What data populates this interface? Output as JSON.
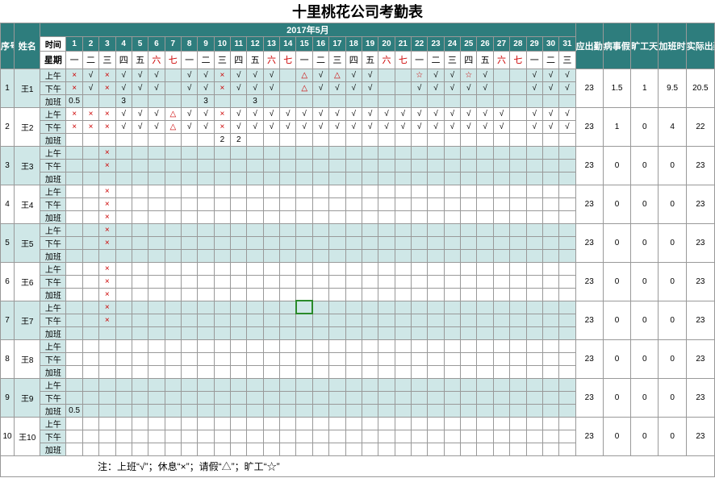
{
  "title": "十里桃花公司考勤表",
  "period": "2017年5月",
  "hdr": {
    "seq": "序号",
    "name": "姓名",
    "time": "时间",
    "wday": "星期",
    "sum1": "应出勤天数",
    "sum2": "病事假天数",
    "sum3": "旷工天数",
    "sum4": "加班时间／h",
    "sum5": "实际出勤天数"
  },
  "sessions": [
    "上午",
    "下午",
    "加班"
  ],
  "days": [
    {
      "n": "1",
      "w": "一"
    },
    {
      "n": "2",
      "w": "二"
    },
    {
      "n": "3",
      "w": "三"
    },
    {
      "n": "4",
      "w": "四"
    },
    {
      "n": "5",
      "w": "五"
    },
    {
      "n": "6",
      "w": "六",
      "r": 1
    },
    {
      "n": "7",
      "w": "七",
      "r": 1
    },
    {
      "n": "8",
      "w": "一"
    },
    {
      "n": "9",
      "w": "二"
    },
    {
      "n": "10",
      "w": "三"
    },
    {
      "n": "11",
      "w": "四"
    },
    {
      "n": "12",
      "w": "五"
    },
    {
      "n": "13",
      "w": "六",
      "r": 1
    },
    {
      "n": "14",
      "w": "七",
      "r": 1
    },
    {
      "n": "15",
      "w": "一"
    },
    {
      "n": "16",
      "w": "二"
    },
    {
      "n": "17",
      "w": "三"
    },
    {
      "n": "18",
      "w": "四"
    },
    {
      "n": "19",
      "w": "五"
    },
    {
      "n": "20",
      "w": "六",
      "r": 1
    },
    {
      "n": "21",
      "w": "七",
      "r": 1
    },
    {
      "n": "22",
      "w": "一"
    },
    {
      "n": "23",
      "w": "二"
    },
    {
      "n": "24",
      "w": "三"
    },
    {
      "n": "25",
      "w": "四"
    },
    {
      "n": "26",
      "w": "五"
    },
    {
      "n": "27",
      "w": "六",
      "r": 1
    },
    {
      "n": "28",
      "w": "七",
      "r": 1
    },
    {
      "n": "29",
      "w": "一"
    },
    {
      "n": "30",
      "w": "二"
    },
    {
      "n": "31",
      "w": "三"
    }
  ],
  "rows": [
    {
      "seq": "1",
      "name": "王1",
      "sums": [
        "23",
        "1.5",
        "1",
        "9.5",
        "20.5"
      ],
      "am": [
        "×",
        "√",
        "×",
        "√",
        "√",
        "√",
        "",
        "√",
        "√",
        "×",
        "√",
        "√",
        "√",
        "",
        "△",
        "√",
        "△",
        "√",
        "√",
        "",
        "",
        "☆",
        "√",
        "√",
        "☆",
        "√",
        "",
        "",
        "√",
        "√",
        "√"
      ],
      "pm": [
        "×",
        "√",
        "×",
        "√",
        "√",
        "√",
        "",
        "√",
        "√",
        "×",
        "√",
        "√",
        "√",
        "",
        "△",
        "√",
        "√",
        "√",
        "√",
        "",
        "",
        "√",
        "√",
        "√",
        "√",
        "√",
        "",
        "",
        "√",
        "√",
        "√"
      ],
      "ot": [
        "0.5",
        "",
        "",
        "3",
        "",
        "",
        "",
        "",
        "3",
        "",
        "",
        "3",
        "",
        "",
        "",
        "",
        "",
        "",
        "",
        "",
        "",
        "",
        "",
        "",
        "",
        "",
        "",
        "",
        "",
        "",
        ""
      ]
    },
    {
      "seq": "2",
      "name": "王2",
      "sums": [
        "23",
        "1",
        "0",
        "4",
        "22"
      ],
      "am": [
        "×",
        "×",
        "×",
        "√",
        "√",
        "√",
        "△",
        "√",
        "√",
        "×",
        "√",
        "√",
        "√",
        "√",
        "√",
        "√",
        "√",
        "√",
        "√",
        "√",
        "√",
        "√",
        "√",
        "√",
        "√",
        "√",
        "√",
        "",
        "√",
        "√",
        "√"
      ],
      "pm": [
        "×",
        "×",
        "×",
        "√",
        "√",
        "√",
        "△",
        "√",
        "√",
        "×",
        "√",
        "√",
        "√",
        "√",
        "√",
        "√",
        "√",
        "√",
        "√",
        "√",
        "√",
        "√",
        "√",
        "√",
        "√",
        "√",
        "√",
        "",
        "√",
        "√",
        "√"
      ],
      "ot": [
        "",
        "",
        "",
        "",
        "",
        "",
        "",
        "",
        "",
        "2",
        "2",
        "",
        "",
        "",
        "",
        "",
        "",
        "",
        "",
        "",
        "",
        "",
        "",
        "",
        "",
        "",
        "",
        "",
        "",
        "",
        ""
      ]
    },
    {
      "seq": "3",
      "name": "王3",
      "sums": [
        "23",
        "0",
        "0",
        "0",
        "23"
      ],
      "am": [
        "",
        "",
        "×",
        "",
        "",
        "",
        "",
        "",
        "",
        "",
        "",
        "",
        "",
        "",
        "",
        "",
        "",
        "",
        "",
        "",
        "",
        "",
        "",
        "",
        "",
        "",
        "",
        "",
        "",
        "",
        ""
      ],
      "pm": [
        "",
        "",
        "×",
        "",
        "",
        "",
        "",
        "",
        "",
        "",
        "",
        "",
        "",
        "",
        "",
        "",
        "",
        "",
        "",
        "",
        "",
        "",
        "",
        "",
        "",
        "",
        "",
        "",
        "",
        "",
        ""
      ],
      "ot": [
        "",
        "",
        "",
        "",
        "",
        "",
        "",
        "",
        "",
        "",
        "",
        "",
        "",
        "",
        "",
        "",
        "",
        "",
        "",
        "",
        "",
        "",
        "",
        "",
        "",
        "",
        "",
        "",
        "",
        "",
        ""
      ]
    },
    {
      "seq": "4",
      "name": "王4",
      "sums": [
        "23",
        "0",
        "0",
        "0",
        "23"
      ],
      "am": [
        "",
        "",
        "×",
        "",
        "",
        "",
        "",
        "",
        "",
        "",
        "",
        "",
        "",
        "",
        "",
        "",
        "",
        "",
        "",
        "",
        "",
        "",
        "",
        "",
        "",
        "",
        "",
        "",
        "",
        "",
        ""
      ],
      "pm": [
        "",
        "",
        "×",
        "",
        "",
        "",
        "",
        "",
        "",
        "",
        "",
        "",
        "",
        "",
        "",
        "",
        "",
        "",
        "",
        "",
        "",
        "",
        "",
        "",
        "",
        "",
        "",
        "",
        "",
        "",
        ""
      ],
      "ot": [
        "",
        "",
        "×",
        "",
        "",
        "",
        "",
        "",
        "",
        "",
        "",
        "",
        "",
        "",
        "",
        "",
        "",
        "",
        "",
        "",
        "",
        "",
        "",
        "",
        "",
        "",
        "",
        "",
        "",
        "",
        ""
      ]
    },
    {
      "seq": "5",
      "name": "王5",
      "sums": [
        "23",
        "0",
        "0",
        "0",
        "23"
      ],
      "am": [
        "",
        "",
        "×",
        "",
        "",
        "",
        "",
        "",
        "",
        "",
        "",
        "",
        "",
        "",
        "",
        "",
        "",
        "",
        "",
        "",
        "",
        "",
        "",
        "",
        "",
        "",
        "",
        "",
        "",
        "",
        ""
      ],
      "pm": [
        "",
        "",
        "×",
        "",
        "",
        "",
        "",
        "",
        "",
        "",
        "",
        "",
        "",
        "",
        "",
        "",
        "",
        "",
        "",
        "",
        "",
        "",
        "",
        "",
        "",
        "",
        "",
        "",
        "",
        "",
        ""
      ],
      "ot": [
        "",
        "",
        "",
        "",
        "",
        "",
        "",
        "",
        "",
        "",
        "",
        "",
        "",
        "",
        "",
        "",
        "",
        "",
        "",
        "",
        "",
        "",
        "",
        "",
        "",
        "",
        "",
        "",
        "",
        "",
        ""
      ]
    },
    {
      "seq": "6",
      "name": "王6",
      "sums": [
        "23",
        "0",
        "0",
        "0",
        "23"
      ],
      "am": [
        "",
        "",
        "×",
        "",
        "",
        "",
        "",
        "",
        "",
        "",
        "",
        "",
        "",
        "",
        "",
        "",
        "",
        "",
        "",
        "",
        "",
        "",
        "",
        "",
        "",
        "",
        "",
        "",
        "",
        "",
        ""
      ],
      "pm": [
        "",
        "",
        "×",
        "",
        "",
        "",
        "",
        "",
        "",
        "",
        "",
        "",
        "",
        "",
        "",
        "",
        "",
        "",
        "",
        "",
        "",
        "",
        "",
        "",
        "",
        "",
        "",
        "",
        "",
        "",
        ""
      ],
      "ot": [
        "",
        "",
        "×",
        "",
        "",
        "",
        "",
        "",
        "",
        "",
        "",
        "",
        "",
        "",
        "",
        "",
        "",
        "",
        "",
        "",
        "",
        "",
        "",
        "",
        "",
        "",
        "",
        "",
        "",
        "",
        ""
      ]
    },
    {
      "seq": "7",
      "name": "王7",
      "sums": [
        "23",
        "0",
        "0",
        "0",
        "23"
      ],
      "am": [
        "",
        "",
        "×",
        "",
        "",
        "",
        "",
        "",
        "",
        "",
        "",
        "",
        "",
        "",
        "",
        "",
        "",
        "",
        "",
        "",
        "",
        "",
        "",
        "",
        "",
        "",
        "",
        "",
        "",
        "",
        ""
      ],
      "pm": [
        "",
        "",
        "×",
        "",
        "",
        "",
        "",
        "",
        "",
        "",
        "",
        "",
        "",
        "",
        "",
        "",
        "",
        "",
        "",
        "",
        "",
        "",
        "",
        "",
        "",
        "",
        "",
        "",
        "",
        "",
        ""
      ],
      "ot": [
        "",
        "",
        "",
        "",
        "",
        "",
        "",
        "",
        "",
        "",
        "",
        "",
        "",
        "",
        "",
        "",
        "",
        "",
        "",
        "",
        "",
        "",
        "",
        "",
        "",
        "",
        "",
        "",
        "",
        "",
        ""
      ]
    },
    {
      "seq": "8",
      "name": "王8",
      "sums": [
        "23",
        "0",
        "0",
        "0",
        "23"
      ],
      "am": [
        "",
        "",
        "",
        "",
        "",
        "",
        "",
        "",
        "",
        "",
        "",
        "",
        "",
        "",
        "",
        "",
        "",
        "",
        "",
        "",
        "",
        "",
        "",
        "",
        "",
        "",
        "",
        "",
        "",
        "",
        ""
      ],
      "pm": [
        "",
        "",
        "",
        "",
        "",
        "",
        "",
        "",
        "",
        "",
        "",
        "",
        "",
        "",
        "",
        "",
        "",
        "",
        "",
        "",
        "",
        "",
        "",
        "",
        "",
        "",
        "",
        "",
        "",
        "",
        ""
      ],
      "ot": [
        "",
        "",
        "",
        "",
        "",
        "",
        "",
        "",
        "",
        "",
        "",
        "",
        "",
        "",
        "",
        "",
        "",
        "",
        "",
        "",
        "",
        "",
        "",
        "",
        "",
        "",
        "",
        "",
        "",
        "",
        ""
      ]
    },
    {
      "seq": "9",
      "name": "王9",
      "sums": [
        "23",
        "0",
        "0",
        "0",
        "23"
      ],
      "am": [
        "",
        "",
        "",
        "",
        "",
        "",
        "",
        "",
        "",
        "",
        "",
        "",
        "",
        "",
        "",
        "",
        "",
        "",
        "",
        "",
        "",
        "",
        "",
        "",
        "",
        "",
        "",
        "",
        "",
        "",
        ""
      ],
      "pm": [
        "",
        "",
        "",
        "",
        "",
        "",
        "",
        "",
        "",
        "",
        "",
        "",
        "",
        "",
        "",
        "",
        "",
        "",
        "",
        "",
        "",
        "",
        "",
        "",
        "",
        "",
        "",
        "",
        "",
        "",
        ""
      ],
      "ot": [
        "0.5",
        "",
        "",
        "",
        "",
        "",
        "",
        "",
        "",
        "",
        "",
        "",
        "",
        "",
        "",
        "",
        "",
        "",
        "",
        "",
        "",
        "",
        "",
        "",
        "",
        "",
        "",
        "",
        "",
        "",
        ""
      ]
    },
    {
      "seq": "10",
      "name": "王10",
      "sums": [
        "23",
        "0",
        "0",
        "0",
        "23"
      ],
      "am": [
        "",
        "",
        "",
        "",
        "",
        "",
        "",
        "",
        "",
        "",
        "",
        "",
        "",
        "",
        "",
        "",
        "",
        "",
        "",
        "",
        "",
        "",
        "",
        "",
        "",
        "",
        "",
        "",
        "",
        "",
        ""
      ],
      "pm": [
        "",
        "",
        "",
        "",
        "",
        "",
        "",
        "",
        "",
        "",
        "",
        "",
        "",
        "",
        "",
        "",
        "",
        "",
        "",
        "",
        "",
        "",
        "",
        "",
        "",
        "",
        "",
        "",
        "",
        "",
        ""
      ],
      "ot": [
        "",
        "",
        "",
        "",
        "",
        "",
        "",
        "",
        "",
        "",
        "",
        "",
        "",
        "",
        "",
        "",
        "",
        "",
        "",
        "",
        "",
        "",
        "",
        "",
        "",
        "",
        "",
        "",
        "",
        "",
        ""
      ]
    }
  ],
  "selected": {
    "row": 6,
    "session": 0,
    "day": 14
  },
  "legend": "注：上班“√”；休息“×”；请假“△”；旷工“☆”"
}
